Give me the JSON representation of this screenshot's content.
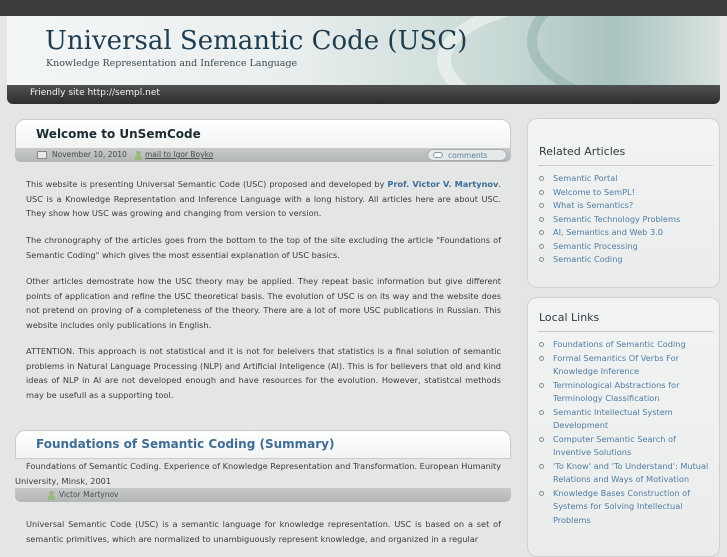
{
  "header": {
    "title": "Universal Semantic Code (USC)",
    "subtitle": "Knowledge Representation and Inference Language"
  },
  "nav": {
    "friendly_link": "Friendly site http://sempl.net"
  },
  "post1": {
    "title": "Welcome to UnSemCode",
    "date": "November 10, 2010",
    "author_link": "mail to Igor Boyko",
    "comments_label": "comments",
    "p1_before": "This website is presenting Universal Semantic Code (USC) proposed and developed by ",
    "p1_author": "Prof. Victor V. Martynov",
    "p1_after": ". USC is a Knowledge Representation and Inference Language with a long history. All articles here are about USC. They show how USC was growing and changing from version to version.",
    "p2": "The chronography of the articles goes from the bottom to the top of the site excluding the article \"Foundations of Semantic Coding\" which gives the most essential explanation of USC basics.",
    "p3": "Other articles demostrate how the USC theory may be applied. They repeat basic information but give different points of application and refine the USC theoretical basis. The evolution of USC is on its way and the website does not pretend on proving of a completeness of the theory. There are a lot of more USC publications in Russian. This website includes only publications in English.",
    "p4": "ATTENTION. This approach is not statistical and it is not for beleivers that statistics is a final solution of semantic problems in Natural Language Processing (NLP) and Artificial Inteligence (AI). This is for believers that old and kind ideas of NLP in AI are not developed enough and have resources for the evolution. However, statistcal methods may be usefull as a supporting tool."
  },
  "post2": {
    "title": "Foundations of Semantic Coding (Summary)",
    "sub": "Foundations of Semantic Coding. Experience of Knowledge Representation and Transformation. European Humanity University, Minsk, 2001",
    "author": "Victor Martynov",
    "p1": "Universal Semantic Code (USC) is a semantic language for knowledge representation. USC is based on a set of semantic primitives, which are normalized to unambiguously represent knowledge, and organized in a regular"
  },
  "sidebar": {
    "related_title": "Related Articles",
    "related": [
      "Semantic Portal",
      "Welcome to SemPL!",
      "What is Semantics?",
      "Semantic Technology Problems",
      "AI, Semantics and Web 3.0",
      "Semantic Processing",
      "Semantic Coding"
    ],
    "local_title": "Local Links",
    "local": [
      "Foundations of Semantic Coding",
      "Formal Semantics Of Verbs For Knowledge Inference",
      "Terminological Abstractions for Terminology Classification",
      "Semantic Intellectual System Development",
      "Computer Semantic Search of Inventive Solutions",
      "'To Know' and 'To Understand': Mutual Relations and Ways of Motivation",
      "Knowledge Bases Construction of Systems for Solving Intellectual Problems"
    ]
  }
}
